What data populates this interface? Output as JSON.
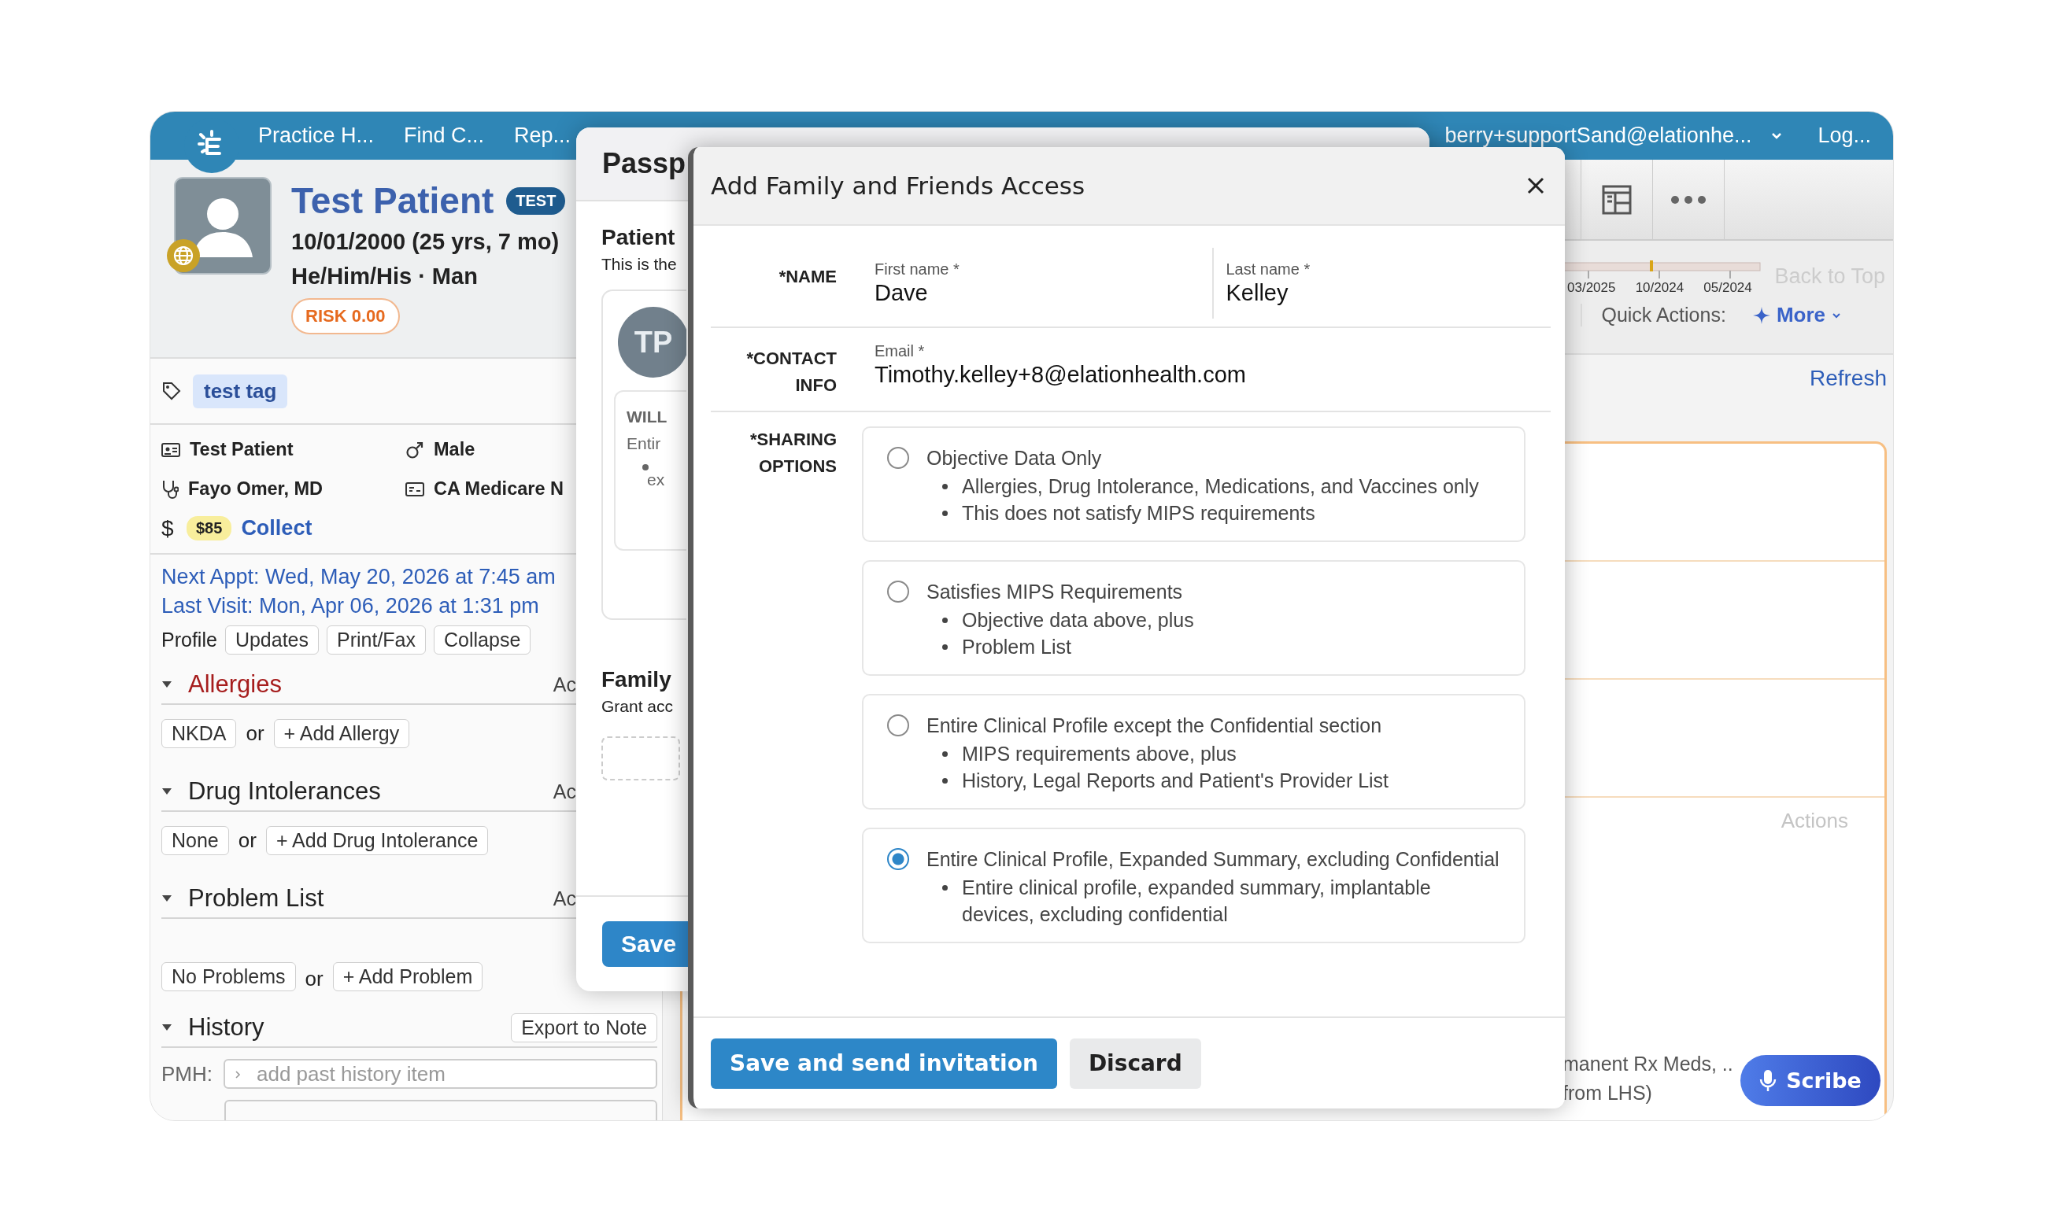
{
  "top_bar": {
    "nav": [
      "Practice H...",
      "Find C...",
      "Rep..."
    ],
    "user": "berry+supportSand@elationhe...",
    "logout": "Log..."
  },
  "patient": {
    "name": "Test Patient",
    "badge": "TEST",
    "dob": "10/01/2000 (25 yrs, 7 mo)",
    "identity": "He/Him/His · Man",
    "risk": "RISK 0.00",
    "tags": [
      "test tag"
    ],
    "info": [
      {
        "kind": "id",
        "text": "Test Patient"
      },
      {
        "kind": "sex",
        "text": "Male"
      },
      {
        "kind": "provider",
        "text": "Fayo Omer, MD"
      },
      {
        "kind": "insurance",
        "text": "CA Medicare N"
      }
    ],
    "balance": {
      "sign": "$",
      "amount": "$85",
      "action": "Collect"
    },
    "next_appt": "Next Appt: Wed, May 20, 2026 at 7:45 am",
    "last_visit": "Last Visit: Mon, Apr 06, 2026 at 1:31 pm",
    "profile_label": "Profile",
    "profile_buttons": [
      "Updates",
      "Print/Fax",
      "Collapse"
    ],
    "sections": [
      {
        "title": "Allergies",
        "alert": true,
        "action": "Ac",
        "chips": [
          "NKDA",
          "+ Add Allergy"
        ],
        "joiner": "or"
      },
      {
        "title": "Drug Intolerances",
        "alert": false,
        "action": "Ac",
        "chips": [
          "None",
          "+ Add Drug Intolerance"
        ],
        "joiner": "or"
      },
      {
        "title": "Problem List",
        "alert": false,
        "action": "Ac",
        "chips": [
          "No Problems",
          "+ Add Problem"
        ],
        "joiner": "or"
      }
    ],
    "history": {
      "title": "History",
      "button": "Export to Note",
      "label": "PMH:",
      "placeholder": "add past history item"
    }
  },
  "passport": {
    "title": "Passp",
    "section1": "Patient",
    "text1": "This is the",
    "avatar": "TP",
    "card_title": "WILL",
    "card_text": "Entir",
    "card_bullet": "ex",
    "section2": "Family",
    "text2": "Grant acc",
    "save": "Save"
  },
  "main": {
    "timeline_labels": [
      "03/2025",
      "10/2024",
      "05/2024"
    ],
    "back_to_top": "Back to Top",
    "quick_actions": "Quick Actions:",
    "more": "More",
    "refresh": "Refresh",
    "actions": "Actions",
    "snippets": [
      "manent Rx Meds, ..",
      "from LHS)"
    ],
    "scribe": "Scribe"
  },
  "dialog": {
    "title": "Add Family and Friends Access",
    "name_label": "*NAME",
    "first_label": "First name *",
    "first_value": "Dave",
    "last_label": "Last name *",
    "last_value": "Kelley",
    "contact_label": "*CONTACT INFO",
    "email_label": "Email *",
    "email_value": "Timothy.kelley+8@elationhealth.com",
    "sharing_label": "*SHARING OPTIONS",
    "options": [
      {
        "title": "Objective Data Only",
        "selected": false,
        "bullets": [
          "Allergies, Drug Intolerance, Medications, and Vaccines only",
          "This does not satisfy MIPS requirements"
        ]
      },
      {
        "title": "Satisfies MIPS Requirements",
        "selected": false,
        "bullets": [
          "Objective data above, plus",
          "Problem List"
        ]
      },
      {
        "title": "Entire Clinical Profile except the Confidential section",
        "selected": false,
        "bullets": [
          "MIPS requirements above, plus",
          "History, Legal Reports and Patient's Provider List"
        ]
      },
      {
        "title": "Entire Clinical Profile, Expanded Summary, excluding Confidential",
        "selected": true,
        "bullets": [
          "Entire clinical profile, expanded summary, implantable devices, excluding confidential"
        ]
      }
    ],
    "buttons": [
      {
        "label": "Save and send invitation",
        "kind": "primary"
      },
      {
        "label": "Discard",
        "kind": "secondary"
      }
    ]
  }
}
